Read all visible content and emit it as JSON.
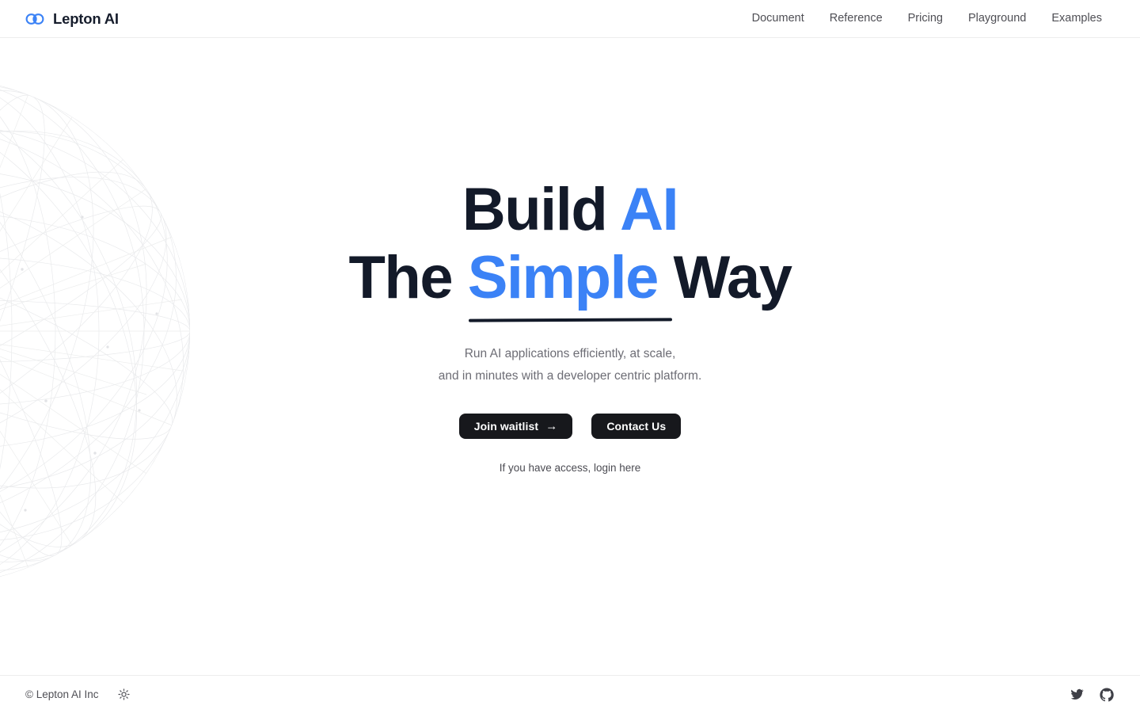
{
  "brand": {
    "name": "Lepton AI",
    "logo_icon": "lepton-logo-icon",
    "accent_color": "#3b82f6"
  },
  "header": {
    "nav": [
      {
        "label": "Document"
      },
      {
        "label": "Reference"
      },
      {
        "label": "Pricing"
      },
      {
        "label": "Playground"
      },
      {
        "label": "Examples"
      }
    ]
  },
  "hero": {
    "headline": {
      "line1_part1": "Build ",
      "line1_accent": "AI",
      "line2_part1": "The ",
      "line2_accent": "Simple",
      "line2_part2": " Way"
    },
    "subtitle_line1": "Run AI applications efficiently, at scale,",
    "subtitle_line2": "and in minutes with a developer centric platform.",
    "primary_button": "Join waitlist",
    "primary_button_icon": "arrow-right-icon",
    "secondary_button": "Contact Us",
    "login_note": "If you have access, login here",
    "background_graphic": "network-sphere-graphic"
  },
  "footer": {
    "copyright": "© Lepton AI Inc",
    "theme_toggle_icon": "sun-icon",
    "social": [
      {
        "name": "twitter-icon"
      },
      {
        "name": "github-icon"
      }
    ]
  }
}
